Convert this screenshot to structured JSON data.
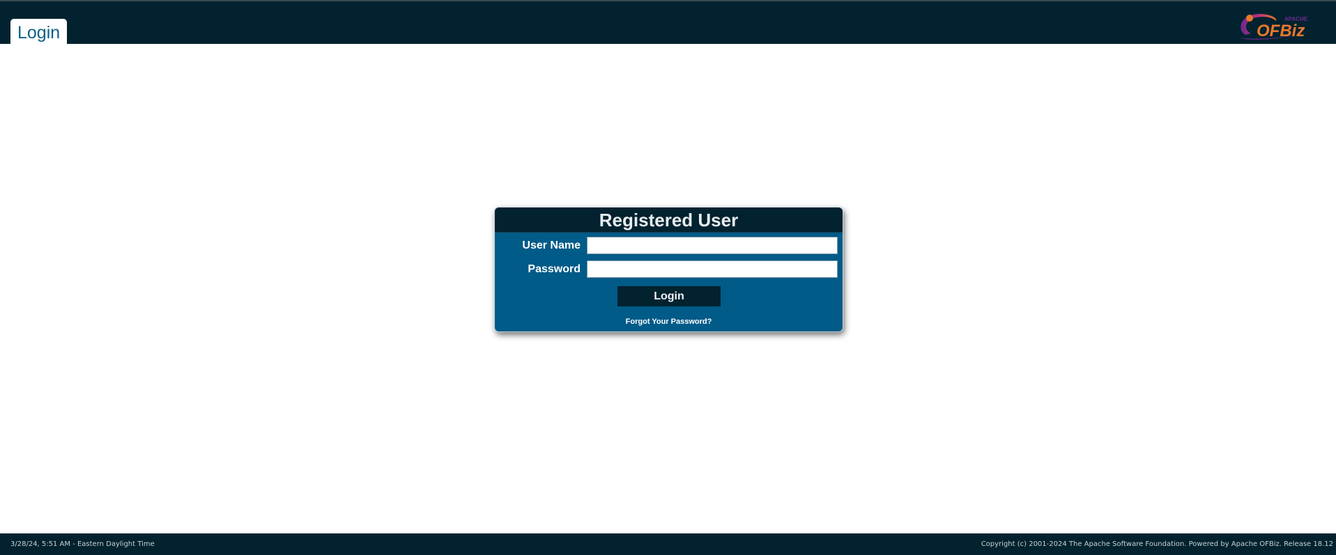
{
  "header": {
    "tab_label": "Login",
    "logo": {
      "icon": "apache-ofbiz-logo",
      "text": "OFBiz",
      "small_text": "APACHE"
    },
    "colors": {
      "bar": "#02222f",
      "tab_text": "#0e5f88"
    }
  },
  "login_form": {
    "title": "Registered User",
    "username_label": "User Name",
    "username_value": "",
    "password_label": "Password",
    "password_value": "",
    "submit_label": "Login",
    "forgot_password_label": "Forgot Your Password?",
    "colors": {
      "panel": "#005b88",
      "header": "#02222f",
      "button": "#02222f"
    }
  },
  "footer": {
    "timestamp": "3/28/24, 5:51 AM - Eastern Daylight Time",
    "copyright_prefix": "Copyright (c) 2001-2024 ",
    "foundation_link": "The Apache Software Foundation",
    "powered_by_prefix": ". Powered by ",
    "ofbiz_link": "Apache OFBiz",
    "release": ". Release 18.12"
  }
}
